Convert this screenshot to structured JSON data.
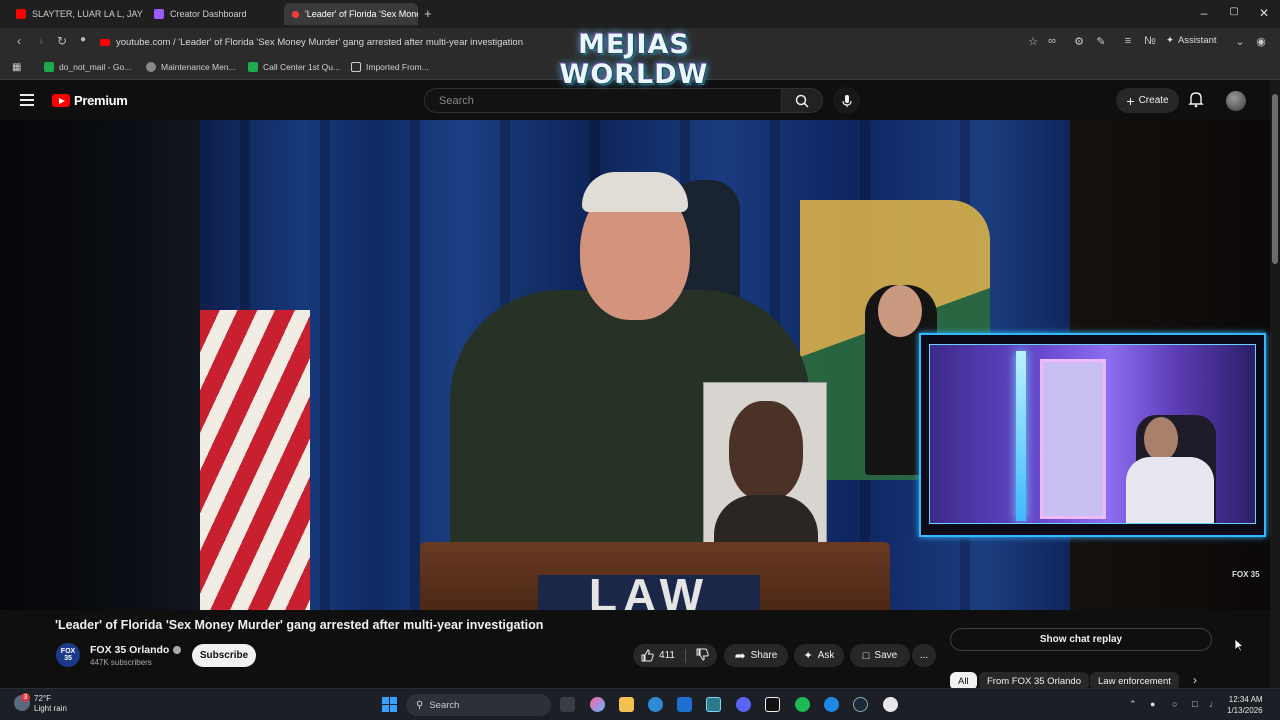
{
  "browser": {
    "tabs": [
      {
        "title": "SLAYTER, LUAR LA L, JAY WH..."
      },
      {
        "title": "Creator Dashboard"
      },
      {
        "title": "'Leader' of Florida 'Sex Mone..."
      }
    ],
    "new_tab_symbol": "+",
    "url": "youtube.com / 'Leader' of Florida 'Sex Money Murder' gang arrested after multi-year investigation",
    "assistant_label": "Assistant",
    "bookmarks": [
      {
        "label": "do_not_mail - Go..."
      },
      {
        "label": "Maintenance Men..."
      },
      {
        "label": "Call Center 1st Qu..."
      },
      {
        "label": "Imported From..."
      }
    ]
  },
  "overlay_logo": {
    "line1": "MEJIAS",
    "line2": "WORLDW"
  },
  "youtube": {
    "logo_text": "Premium",
    "search_placeholder": "Search",
    "create_label": "Create",
    "video": {
      "title": "'Leader' of Florida 'Sex Money Murder' gang arrested after multi-year investigation",
      "watermark": "FOX 35",
      "podium_text": "LAW"
    },
    "channel": {
      "logo_text": "FOX 35",
      "name": "FOX 35 Orlando",
      "subscribers": "447K subscribers",
      "subscribe_label": "Subscribe"
    },
    "actions": {
      "likes": "411",
      "share": "Share",
      "ask": "Ask",
      "save": "Save",
      "more": "..."
    },
    "chat_replay_label": "Show chat replay",
    "chips": [
      {
        "label": "All",
        "selected": true
      },
      {
        "label": "From FOX 35 Orlando",
        "selected": false
      },
      {
        "label": "Law enforcement",
        "selected": false
      }
    ]
  },
  "taskbar": {
    "weather_temp": "72°F",
    "weather_desc": "Light rain",
    "weather_badge": "3",
    "search_label": "Search",
    "time": "12:34 AM",
    "date": "1/13/2026"
  },
  "colors": {
    "accent_red": "#ff0000",
    "cam_border": "#35b8ff",
    "background": "#0f0f0f"
  }
}
